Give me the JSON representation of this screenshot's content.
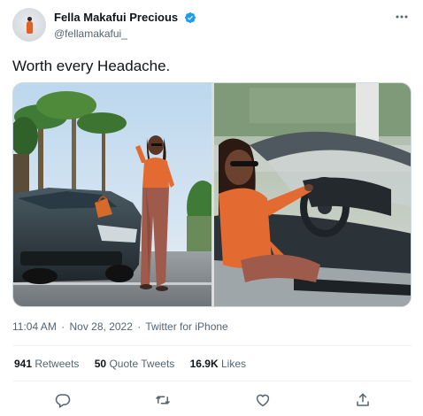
{
  "author": {
    "display_name": "Fella Makafui Precious",
    "handle": "@fellamakafui_",
    "verified": true
  },
  "tweet": {
    "text": "Worth every Headache.",
    "time": "11:04 AM",
    "date": "Nov 28, 2022",
    "source": "Twitter for iPhone",
    "separator": "·"
  },
  "media": {
    "photos": [
      {
        "icon": "photo-woman-standing-by-sports-car"
      },
      {
        "icon": "photo-woman-driving-convertible"
      }
    ]
  },
  "stats": {
    "retweets_count": "941",
    "retweets_label": "Retweets",
    "quotes_count": "50",
    "quotes_label": "Quote Tweets",
    "likes_count": "16.9K",
    "likes_label": "Likes"
  },
  "colors": {
    "verified": "#1d9bf0",
    "secondary_text": "#536471",
    "primary_text": "#0f1419"
  },
  "actions": [
    {
      "icon": "reply-icon"
    },
    {
      "icon": "retweet-icon"
    },
    {
      "icon": "like-icon"
    },
    {
      "icon": "share-icon"
    }
  ]
}
